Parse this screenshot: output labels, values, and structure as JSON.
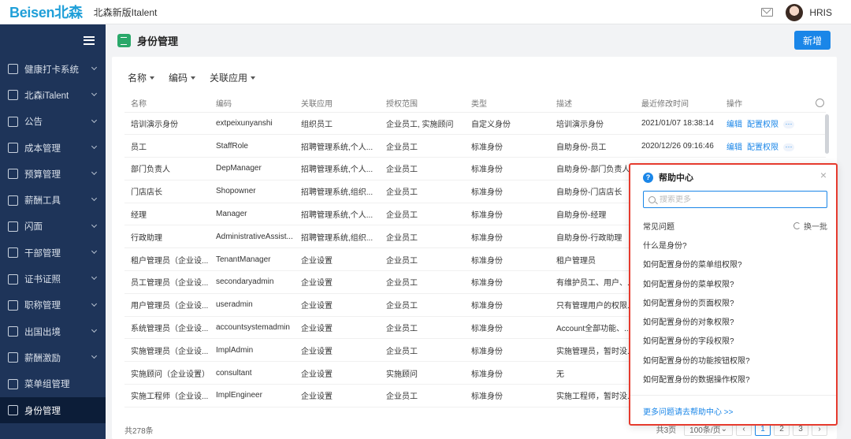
{
  "topbar": {
    "logo": "Beisen北森",
    "app_title": "北森新版Italent",
    "user_name": "HRIS"
  },
  "sidebar": {
    "items": [
      {
        "label": "健康打卡系统",
        "icon": "shield-icon",
        "has_chevron": true
      },
      {
        "label": "北森iTalent",
        "icon": "diamond-icon",
        "has_chevron": true
      },
      {
        "label": "公告",
        "icon": "bulletin-icon",
        "has_chevron": true
      },
      {
        "label": "成本管理",
        "icon": "document-icon",
        "has_chevron": true
      },
      {
        "label": "预算管理",
        "icon": "budget-icon",
        "has_chevron": true
      },
      {
        "label": "薪酬工具",
        "icon": "calculator-icon",
        "has_chevron": true
      },
      {
        "label": "闪面",
        "icon": "id-card-icon",
        "has_chevron": true
      },
      {
        "label": "干部管理",
        "icon": "list-icon",
        "has_chevron": true
      },
      {
        "label": "证书证照",
        "icon": "certificate-icon",
        "has_chevron": true
      },
      {
        "label": "职称管理",
        "icon": "badge-icon",
        "has_chevron": true
      },
      {
        "label": "出国出境",
        "icon": "passport-icon",
        "has_chevron": true
      },
      {
        "label": "薪酬激励",
        "icon": "money-icon",
        "has_chevron": true
      },
      {
        "label": "菜单组管理",
        "icon": "dollar-icon",
        "has_chevron": false
      },
      {
        "label": "身份管理",
        "icon": "command-icon",
        "has_chevron": false,
        "active": true
      }
    ]
  },
  "page": {
    "title": "身份管理",
    "new_button": "新增"
  },
  "filters": [
    "名称",
    "编码",
    "关联应用"
  ],
  "table": {
    "columns": [
      "名称",
      "编码",
      "关联应用",
      "授权范围",
      "类型",
      "描述",
      "最近修改时间",
      "操作"
    ],
    "rows": [
      [
        "培训演示身份",
        "extpeixunyanshi",
        "组织员工",
        "企业员工, 实施顾问",
        "自定义身份",
        "培训演示身份",
        "2021/01/07 18:38:14"
      ],
      [
        "员工",
        "StaffRole",
        "招聘管理系统,个人...",
        "企业员工",
        "标准身份",
        "自助身份-员工",
        "2020/12/26 09:16:46"
      ],
      [
        "部门负责人",
        "DepManager",
        "招聘管理系统,个人...",
        "企业员工",
        "标准身份",
        "自助身份-部门负责人",
        ""
      ],
      [
        "门店店长",
        "Shopowner",
        "招聘管理系统,组织...",
        "企业员工",
        "标准身份",
        "自助身份-门店店长",
        ""
      ],
      [
        "经理",
        "Manager",
        "招聘管理系统,个人...",
        "企业员工",
        "标准身份",
        "自助身份-经理",
        ""
      ],
      [
        "行政助理",
        "AdministrativeAssist...",
        "招聘管理系统,组织...",
        "企业员工",
        "标准身份",
        "自助身份-行政助理",
        ""
      ],
      [
        "租户管理员（企业设...",
        "TenantManager",
        "企业设置",
        "企业员工",
        "标准身份",
        "租户管理员",
        ""
      ],
      [
        "员工管理员（企业设...",
        "secondaryadmin",
        "企业设置",
        "企业员工",
        "标准身份",
        "有维护员工、用户、...",
        ""
      ],
      [
        "用户管理员（企业设...",
        "useradmin",
        "企业设置",
        "企业员工",
        "标准身份",
        "只有管理用户的权限...",
        ""
      ],
      [
        "系统管理员（企业设...",
        "accountsystemadmin",
        "企业设置",
        "企业员工",
        "标准身份",
        "Account全部功能、...",
        ""
      ],
      [
        "实施管理员（企业设...",
        "ImplAdmin",
        "企业设置",
        "企业员工",
        "标准身份",
        "实施管理员，暂时没...",
        ""
      ],
      [
        "实施顾问（企业设置）",
        "consultant",
        "企业设置",
        "实施顾问",
        "标准身份",
        "无",
        ""
      ],
      [
        "实施工程师（企业设...",
        "ImplEngineer",
        "企业设置",
        "企业员工",
        "标准身份",
        "实施工程师，暂时没...",
        ""
      ]
    ],
    "row_actions": [
      "编辑",
      "配置权限",
      "···"
    ],
    "total": "共278条"
  },
  "pagination": {
    "pages_label": "共3页",
    "page_size": "100条/页",
    "pages": [
      "1",
      "2",
      "3"
    ],
    "current": "1"
  },
  "help": {
    "title": "帮助中心",
    "search_placeholder": "搜索更多",
    "faq_label": "常见问题",
    "refresh_label": "换一批",
    "questions": [
      "什么是身份?",
      "如何配置身份的菜单组权限?",
      "如何配置身份的菜单权限?",
      "如何配置身份的页面权限?",
      "如何配置身份的对象权限?",
      "如何配置身份的字段权限?",
      "如何配置身份的功能按钮权限?",
      "如何配置身份的数据操作权限?"
    ],
    "footer_link": "更多问题请去帮助中心 >>"
  },
  "colors": {
    "sidebar_bg": "#1e3459",
    "accent": "#1a86e8",
    "highlight_border": "#e63b2e"
  }
}
